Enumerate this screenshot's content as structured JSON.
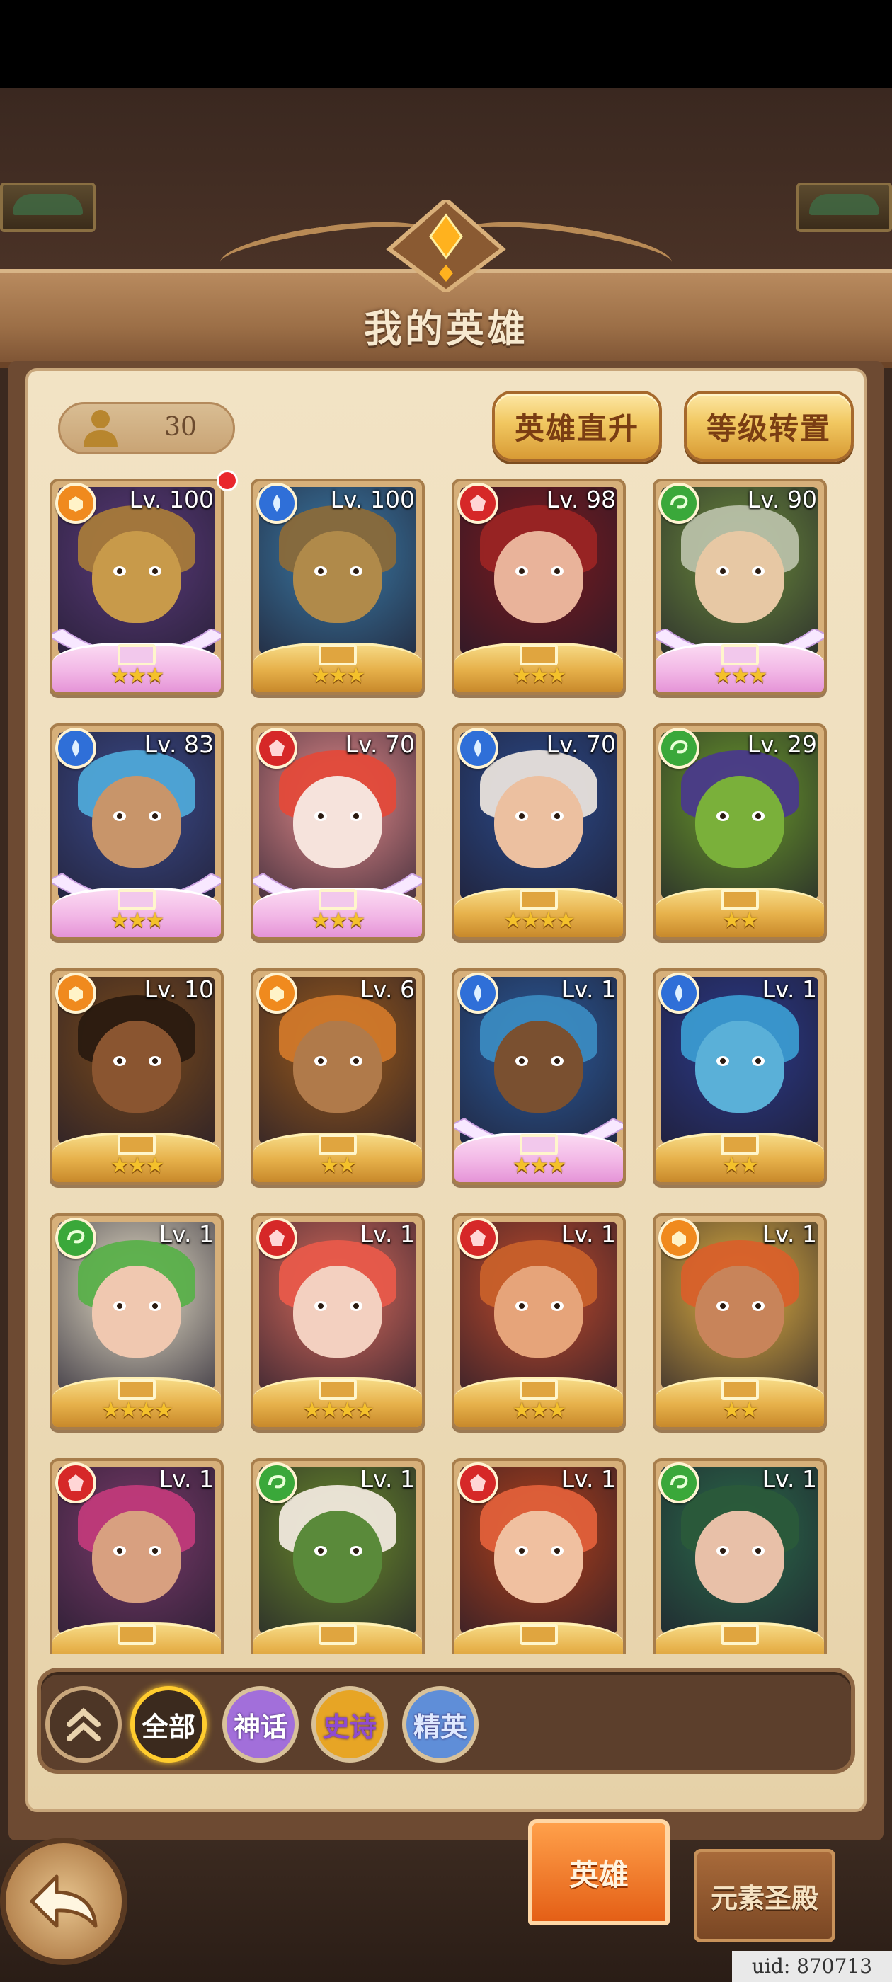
{
  "header": {
    "title": "我的英雄"
  },
  "hero_count": "30",
  "buttons": {
    "hero_boost": "英雄直升",
    "level_transfer": "等级转置"
  },
  "heroes": [
    {
      "level": "Lv. 100",
      "stars": "★★★",
      "element": "orange",
      "rarity": "myth",
      "palette": [
        "#5a3a7a",
        "#c89a4a",
        "#a77a3a"
      ],
      "new": true
    },
    {
      "level": "Lv. 100",
      "stars": "★★★",
      "element": "blue",
      "rarity": "epic",
      "palette": [
        "#3a7aa6",
        "#b08a4a",
        "#8a6a3a"
      ]
    },
    {
      "level": "Lv. 98",
      "stars": "★★★",
      "element": "red",
      "rarity": "epic",
      "palette": [
        "#7a1a1e",
        "#e9b39a",
        "#9a2424"
      ]
    },
    {
      "level": "Lv. 90",
      "stars": "★★★",
      "element": "green",
      "rarity": "myth",
      "palette": [
        "#6a8a3a",
        "#e7c8a4",
        "#b8c0a8"
      ]
    },
    {
      "level": "Lv. 83",
      "stars": "★★★",
      "element": "blue",
      "rarity": "myth",
      "palette": [
        "#3a4a8a",
        "#c8956a",
        "#4fa8d8"
      ]
    },
    {
      "level": "Lv. 70",
      "stars": "★★★",
      "element": "red",
      "rarity": "myth",
      "palette": [
        "#e48a8a",
        "#f6e3dc",
        "#e34a3a"
      ]
    },
    {
      "level": "Lv. 70",
      "stars": "★★★★",
      "element": "blue",
      "rarity": "epic",
      "palette": [
        "#2a4a8a",
        "#ecc0a0",
        "#e8e2dc"
      ]
    },
    {
      "level": "Lv. 29",
      "stars": "★★",
      "element": "green",
      "rarity": "epic",
      "palette": [
        "#6a9a2a",
        "#7ab03a",
        "#4a3a8a"
      ]
    },
    {
      "level": "Lv. 10",
      "stars": "★★★",
      "element": "orange",
      "rarity": "epic",
      "palette": [
        "#7a4a1a",
        "#8a5530",
        "#2a1a10"
      ]
    },
    {
      "level": "Lv. 6",
      "stars": "★★",
      "element": "orange",
      "rarity": "epic",
      "palette": [
        "#9a5a1a",
        "#b07a4a",
        "#d0782a"
      ]
    },
    {
      "level": "Lv. 1",
      "stars": "★★★",
      "element": "blue",
      "rarity": "myth",
      "palette": [
        "#2a5a9a",
        "#7a5030",
        "#3a8ac0"
      ]
    },
    {
      "level": "Lv. 1",
      "stars": "★★",
      "element": "blue",
      "rarity": "epic",
      "palette": [
        "#2a3a8a",
        "#5ab0d8",
        "#3a9ad0"
      ]
    },
    {
      "level": "Lv. 1",
      "stars": "★★★★",
      "element": "green",
      "rarity": "epic",
      "palette": [
        "#e8e0c8",
        "#f0c8b0",
        "#5ab04a"
      ]
    },
    {
      "level": "Lv. 1",
      "stars": "★★★★",
      "element": "red",
      "rarity": "epic",
      "palette": [
        "#d86a5a",
        "#f3d0c0",
        "#e85a4a"
      ]
    },
    {
      "level": "Lv. 1",
      "stars": "★★★",
      "element": "red",
      "rarity": "epic",
      "palette": [
        "#c04a2a",
        "#e6a47a",
        "#c8602a"
      ]
    },
    {
      "level": "Lv. 1",
      "stars": "★★",
      "element": "orange",
      "rarity": "epic",
      "palette": [
        "#e0b040",
        "#c8845a",
        "#d8602a"
      ]
    },
    {
      "level": "Lv. 1",
      "stars": "",
      "element": "red",
      "rarity": "epic",
      "palette": [
        "#7a3a6a",
        "#d8a080",
        "#c03a7a"
      ]
    },
    {
      "level": "Lv. 1",
      "stars": "",
      "element": "green",
      "rarity": "epic",
      "palette": [
        "#6a8a2a",
        "#5a8a3a",
        "#f0e8dc"
      ]
    },
    {
      "level": "Lv. 1",
      "stars": "",
      "element": "red",
      "rarity": "epic",
      "palette": [
        "#b0401a",
        "#f0c0a0",
        "#e0603a"
      ]
    },
    {
      "level": "Lv. 1",
      "stars": "",
      "element": "green",
      "rarity": "epic",
      "palette": [
        "#2a6a4a",
        "#e8c0a8",
        "#2a5a3a"
      ]
    }
  ],
  "element_colors": {
    "orange": "#f08a1e",
    "blue": "#2f6fd8",
    "red": "#d62828",
    "green": "#3aa83a"
  },
  "filters": {
    "all": "全部",
    "myth": "神话",
    "epic": "史诗",
    "elite": "精英"
  },
  "tabs": {
    "hero": "英雄",
    "temple": "元素圣殿"
  },
  "uid": "uid: 870713"
}
